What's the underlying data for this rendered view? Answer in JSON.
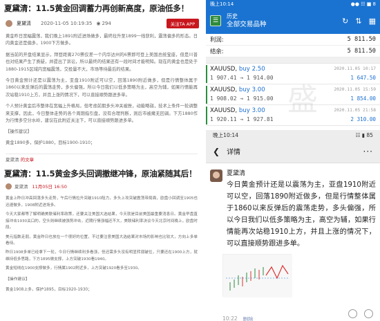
{
  "left": {
    "title1": "夏黛清：11.5黄金回调蓄力再创新高度，原油低多！",
    "meta1": {
      "author": "夏黛清",
      "date": "2020-11-05 10:19:35",
      "views": "294",
      "follow": "关注TA APP"
    },
    "paras1": [
      "黄金昨日宽幅震荡，我们晚上1891附近进场做多，最终拉升至1899一线获利，震荡偏多的形态。日内黄金还是偏多，1900下方做多。",
      "据当前的开盘结果显示，拜登距离270票仅差一个内华达州的6票即可登上美国总统宝座，但是川普也对结果产生了质疑，并提出了诉讼，所以最终的结果还有一段时间才能明知。现在的黄金也是处于1880-1915区域内宽幅震荡，交投量不大，市场等待最后的结果。",
      "今日黄金预计还是以震荡为主，亚盘1910附近可以空，回落1890附近做多，但是行情整体属于1860以来反弹后的震荡走势，多头偏强，所以今日我们以低多策略为主，高空为辅，如果行情能再次站稳1910上方，并且上涨的情况下，可以直接顺势跟进多单。",
      "个人预计黄金后市整体在宽幅上升格局，但考虑前期多头冲关被挫，动能略弱，技术上条件一轮调整来支撑，因此，今日整体走势的各个周期指引盘，没有合理判断，则后市被瘫无回调。下方1880作为行情多空分水岭，建议在此附近关注下，可以直接顺势跟进多单。"
    ],
    "op_label1": "【操作建议】",
    "op1": "黄金1890多，保护1880，目标1900-1910；",
    "source_prefix": "夏黛清 ",
    "source_hl": "的文章",
    "title2": "夏黛清：11.5黄金多头回调撤继冲锋，原油紧随其后！",
    "meta2": {
      "author": "夏黛清",
      "date": "11月05日 16:50"
    },
    "paras2": [
      "黄金上昨日冲高回落多头走势，午后行情拉升突破1910阻力，多头上攻突破震荡带局面，欧盘小回调至1905也迅速做多，1908附近进场多。",
      "今天大家都等了解明确美联储利率政策，还要关注美国大选结果，今天就是目前美国最重要消息日。黄金早盘直接冲击1930关口的，空头则继续被强势冲击，近期行情涨幅还不大，美联储利率决议今天北京时间晚上，欧盘时段。",
      "美元指数走弱，黄金昨日也放在一个很好的位置，不过要注意美国大选结果对市场的影响也比较大，方向上多单看待。",
      "昨日1908多单已经拿下一轮，今日行情继续利多看涨，但还需多头没有明显转弱破位，只要还在1900上方，就维持低多思路，下方1895做支撑，上方突破1930看1940。",
      "黄金短线在1900支撑做多，行情属1902附近多，上方突破1920看多至1930。"
    ],
    "op_label2": "【操作建议】",
    "op2": "黄金1908上多，保护1895，目标1920-1930；"
  },
  "trade": {
    "status_time": "晚上10:14",
    "status_right": "●● ☷ ■ 8",
    "app_small": "历史",
    "app_title": "全部交易品种",
    "profit_label": "利润:",
    "profit_value": "5 811.50",
    "balance_label": "结余:",
    "balance_value": "5 811.50",
    "rows": [
      {
        "sym": "XAUUSD,",
        "side": "buy 2.50",
        "time": "2020.11.05 10:17",
        "prices": "1 907.41 → 1 914.00",
        "profit": "1 647.50"
      },
      {
        "sym": "XAUUSD,",
        "side": "buy 3.00",
        "time": "2020.11.05 15:59",
        "prices": "1 908.02 → 1 915.00",
        "profit": "1 854.00"
      },
      {
        "sym": "XAUUSD,",
        "side": "buy 3.00",
        "time": "2020.11.05 21:58",
        "prices": "1 920.11 → 1 927.81",
        "profit": "2 310.00"
      }
    ],
    "watermark": "盛 汇"
  },
  "detail": {
    "status_time": "晚上10:14",
    "status_right": "☷ ▮ 85",
    "header_title": "详情",
    "more_icon": "···",
    "name": "夏黛清",
    "text": "今日黄金预计还是以震荡为主，亚盘1910附近可以空，回落1890附近做多，但是行情整体属于1860以来反弹后的震荡走势，多头偏强，所以今日我们以低多策略为主，高空为辅，如果行情能再次站稳1910上方，并且上涨的情况下，可以直接顺势跟进多单。",
    "time": "10:22",
    "delete": "删除"
  }
}
